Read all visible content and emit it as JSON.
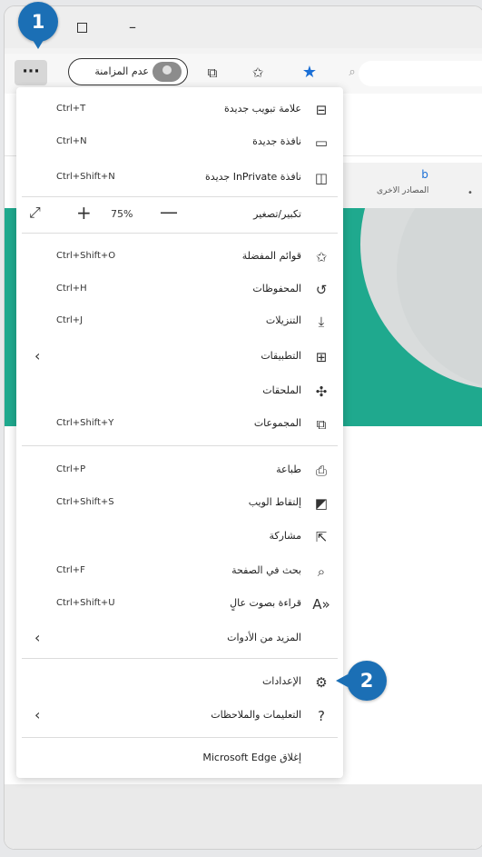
{
  "callouts": {
    "first": "1",
    "second": "2"
  },
  "toolbar": {
    "more_label": "···",
    "profile_label": "عدم المزامنة",
    "icons": [
      "collections-icon",
      "favorites-list-icon",
      "star-icon",
      "search-icon"
    ]
  },
  "page": {
    "panel_text": "المصادر الاخرى"
  },
  "zoom": {
    "label": "تكبير/تصغير",
    "value": "75%",
    "plus": "+",
    "minus": "—"
  },
  "menu": {
    "new_tab": {
      "label": "علامة تبويب جديدة",
      "shortcut": "Ctrl+T"
    },
    "new_window": {
      "label": "نافذة جديدة",
      "shortcut": "Ctrl+N"
    },
    "inprivate": {
      "label": "نافذة InPrivate جديدة",
      "shortcut": "Ctrl+Shift+N"
    },
    "favorites": {
      "label": "قوائم المفضلة",
      "shortcut": "Ctrl+Shift+O"
    },
    "history": {
      "label": "المحفوظات",
      "shortcut": "Ctrl+H"
    },
    "downloads": {
      "label": "التنزيلات",
      "shortcut": "Ctrl+J"
    },
    "apps": {
      "label": "التطبيقات"
    },
    "extensions": {
      "label": "الملحقات"
    },
    "collections": {
      "label": "المجموعات",
      "shortcut": "Ctrl+Shift+Y"
    },
    "print": {
      "label": "طباعة",
      "shortcut": "Ctrl+P"
    },
    "web_capture": {
      "label": "إلتقاط الويب",
      "shortcut": "Ctrl+Shift+S"
    },
    "share": {
      "label": "مشاركة"
    },
    "find": {
      "label": "بحث في الصفحة",
      "shortcut": "Ctrl+F"
    },
    "read_aloud": {
      "label": "قراءة بصوت عالٍ",
      "shortcut": "Ctrl+Shift+U"
    },
    "more_tools": {
      "label": "المزيد من الأدوات"
    },
    "settings": {
      "label": "الإعدادات"
    },
    "help": {
      "label": "التعليمات والملاحظات"
    },
    "close": {
      "label": "إغلاق Microsoft Edge"
    }
  },
  "colors": {
    "accent": "#1b6fb5",
    "teal": "#1fa98e",
    "star": "#1a6fd6"
  }
}
